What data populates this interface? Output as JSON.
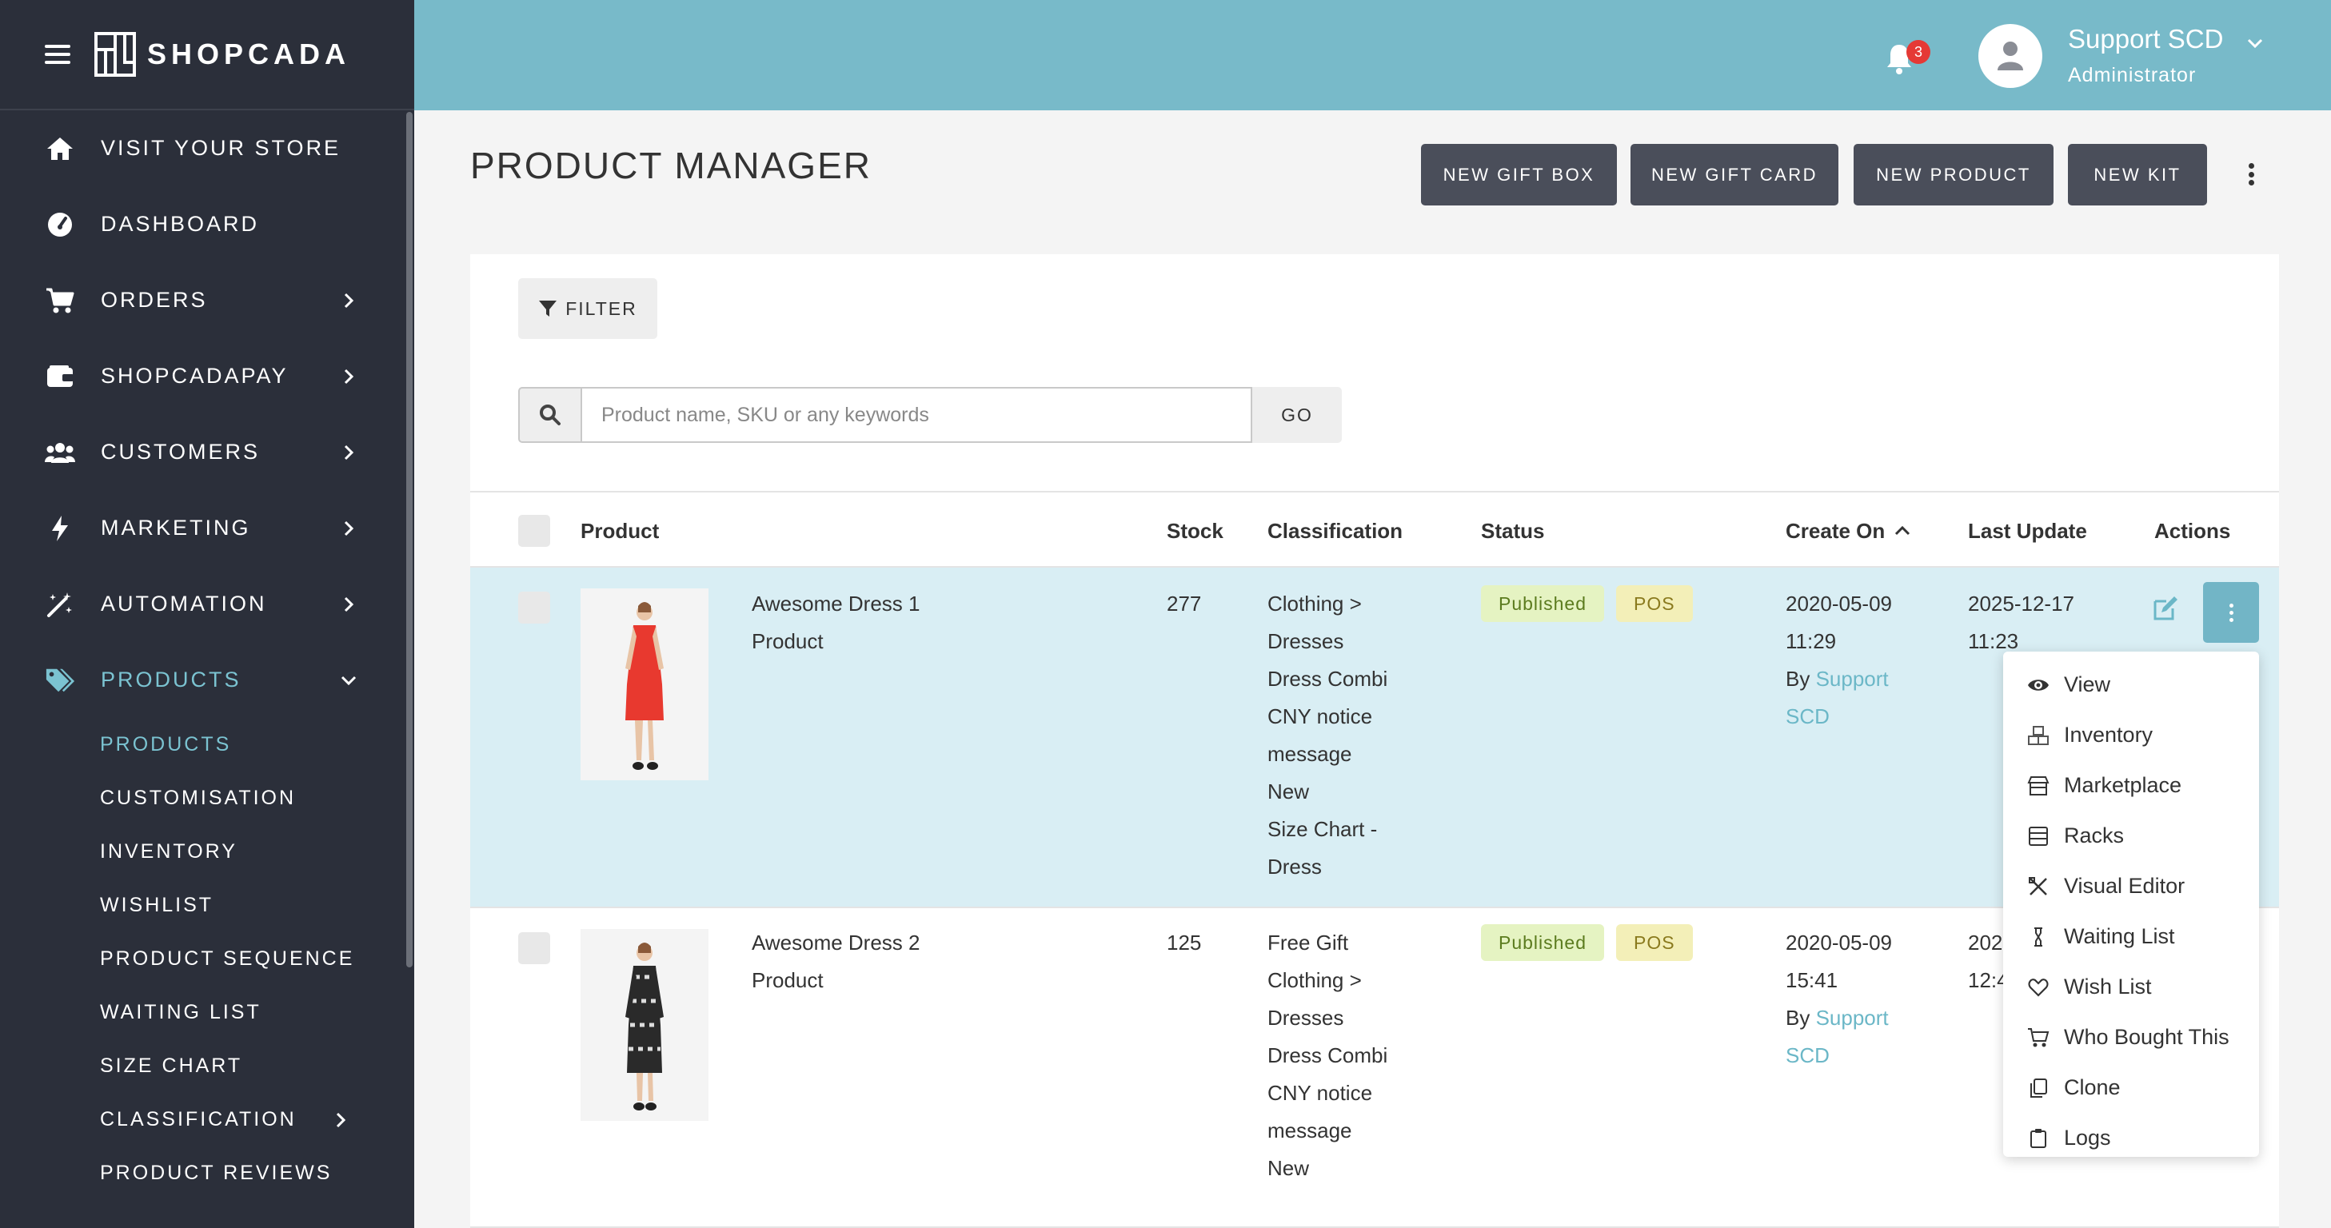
{
  "brand": {
    "name": "SHOPCADA"
  },
  "sidebar": {
    "items": [
      {
        "label": "VISIT YOUR STORE",
        "icon": "home-icon",
        "has_children": false
      },
      {
        "label": "DASHBOARD",
        "icon": "gauge-icon",
        "has_children": false
      },
      {
        "label": "ORDERS",
        "icon": "cart-icon",
        "has_children": true
      },
      {
        "label": "SHOPCADAPAY",
        "icon": "wallet-icon",
        "has_children": true
      },
      {
        "label": "CUSTOMERS",
        "icon": "users-icon",
        "has_children": true
      },
      {
        "label": "MARKETING",
        "icon": "bolt-icon",
        "has_children": true
      },
      {
        "label": "AUTOMATION",
        "icon": "magic-wand-icon",
        "has_children": true
      },
      {
        "label": "PRODUCTS",
        "icon": "tags-icon",
        "has_children": true,
        "expanded": true,
        "active": true
      }
    ],
    "sub_items": [
      {
        "label": "PRODUCTS",
        "active": true
      },
      {
        "label": "CUSTOMISATION"
      },
      {
        "label": "INVENTORY"
      },
      {
        "label": "WISHLIST"
      },
      {
        "label": "PRODUCT SEQUENCE"
      },
      {
        "label": "WAITING LIST"
      },
      {
        "label": "SIZE CHART"
      },
      {
        "label": "CLASSIFICATION",
        "has_children": true
      },
      {
        "label": "PRODUCT REVIEWS"
      }
    ]
  },
  "header": {
    "notification_count": "3",
    "user_name": "Support SCD",
    "user_role": "Administrator"
  },
  "page": {
    "title": "PRODUCT MANAGER",
    "buttons": [
      "NEW GIFT BOX",
      "NEW GIFT CARD",
      "NEW PRODUCT",
      "NEW KIT"
    ]
  },
  "filter": {
    "label": "FILTER"
  },
  "search": {
    "placeholder": "Product name, SKU or any keywords",
    "value": "",
    "go_label": "GO"
  },
  "table": {
    "columns": [
      "Product",
      "Stock",
      "Classification",
      "Status",
      "Create On",
      "Last Update",
      "Actions"
    ],
    "sort_column": "Create On",
    "sort_direction": "ascending",
    "rows": [
      {
        "name": "Awesome Dress 1",
        "type": "Product",
        "stock": "277",
        "classification": [
          "Clothing >",
          "Dresses",
          "Dress Combi",
          "CNY notice",
          "message",
          "New",
          "Size Chart -",
          "Dress"
        ],
        "status": [
          "Published",
          "POS"
        ],
        "created_date": "2020-05-09",
        "created_time": "11:29",
        "created_by_prefix": "By",
        "created_by_line1": "Support",
        "created_by_line2": "SCD",
        "updated_date": "2025-12-17",
        "updated_time": "11:23",
        "dress_color": "#e8392f"
      },
      {
        "name": "Awesome Dress 2",
        "type": "Product",
        "stock": "125",
        "classification": [
          "Free Gift",
          "Clothing >",
          "Dresses",
          "Dress Combi",
          "CNY notice",
          "message",
          "New"
        ],
        "status": [
          "Published",
          "POS"
        ],
        "created_date": "2020-05-09",
        "created_time": "15:41",
        "created_by_prefix": "By",
        "created_by_line1": "Support",
        "created_by_line2": "SCD",
        "updated_date": "202",
        "updated_time": "12:4",
        "dress_color": "#2a2a2a"
      }
    ]
  },
  "action_menu": {
    "items": [
      {
        "label": "View",
        "icon": "eye-icon"
      },
      {
        "label": "Inventory",
        "icon": "boxes-icon"
      },
      {
        "label": "Marketplace",
        "icon": "store-icon"
      },
      {
        "label": "Racks",
        "icon": "racks-icon"
      },
      {
        "label": "Visual Editor",
        "icon": "pencil-ruler-icon"
      },
      {
        "label": "Waiting List",
        "icon": "hourglass-icon"
      },
      {
        "label": "Wish List",
        "icon": "heart-icon"
      },
      {
        "label": "Who Bought This",
        "icon": "cart-outline-icon"
      },
      {
        "label": "Clone",
        "icon": "copy-icon"
      },
      {
        "label": "Logs",
        "icon": "clipboard-icon"
      }
    ]
  },
  "colors": {
    "header": "#78bac9",
    "sidebar": "#2b2f3a",
    "accent": "#7bc3d1",
    "button": "#4a4e5a",
    "row_highlight": "#d9eef4"
  }
}
